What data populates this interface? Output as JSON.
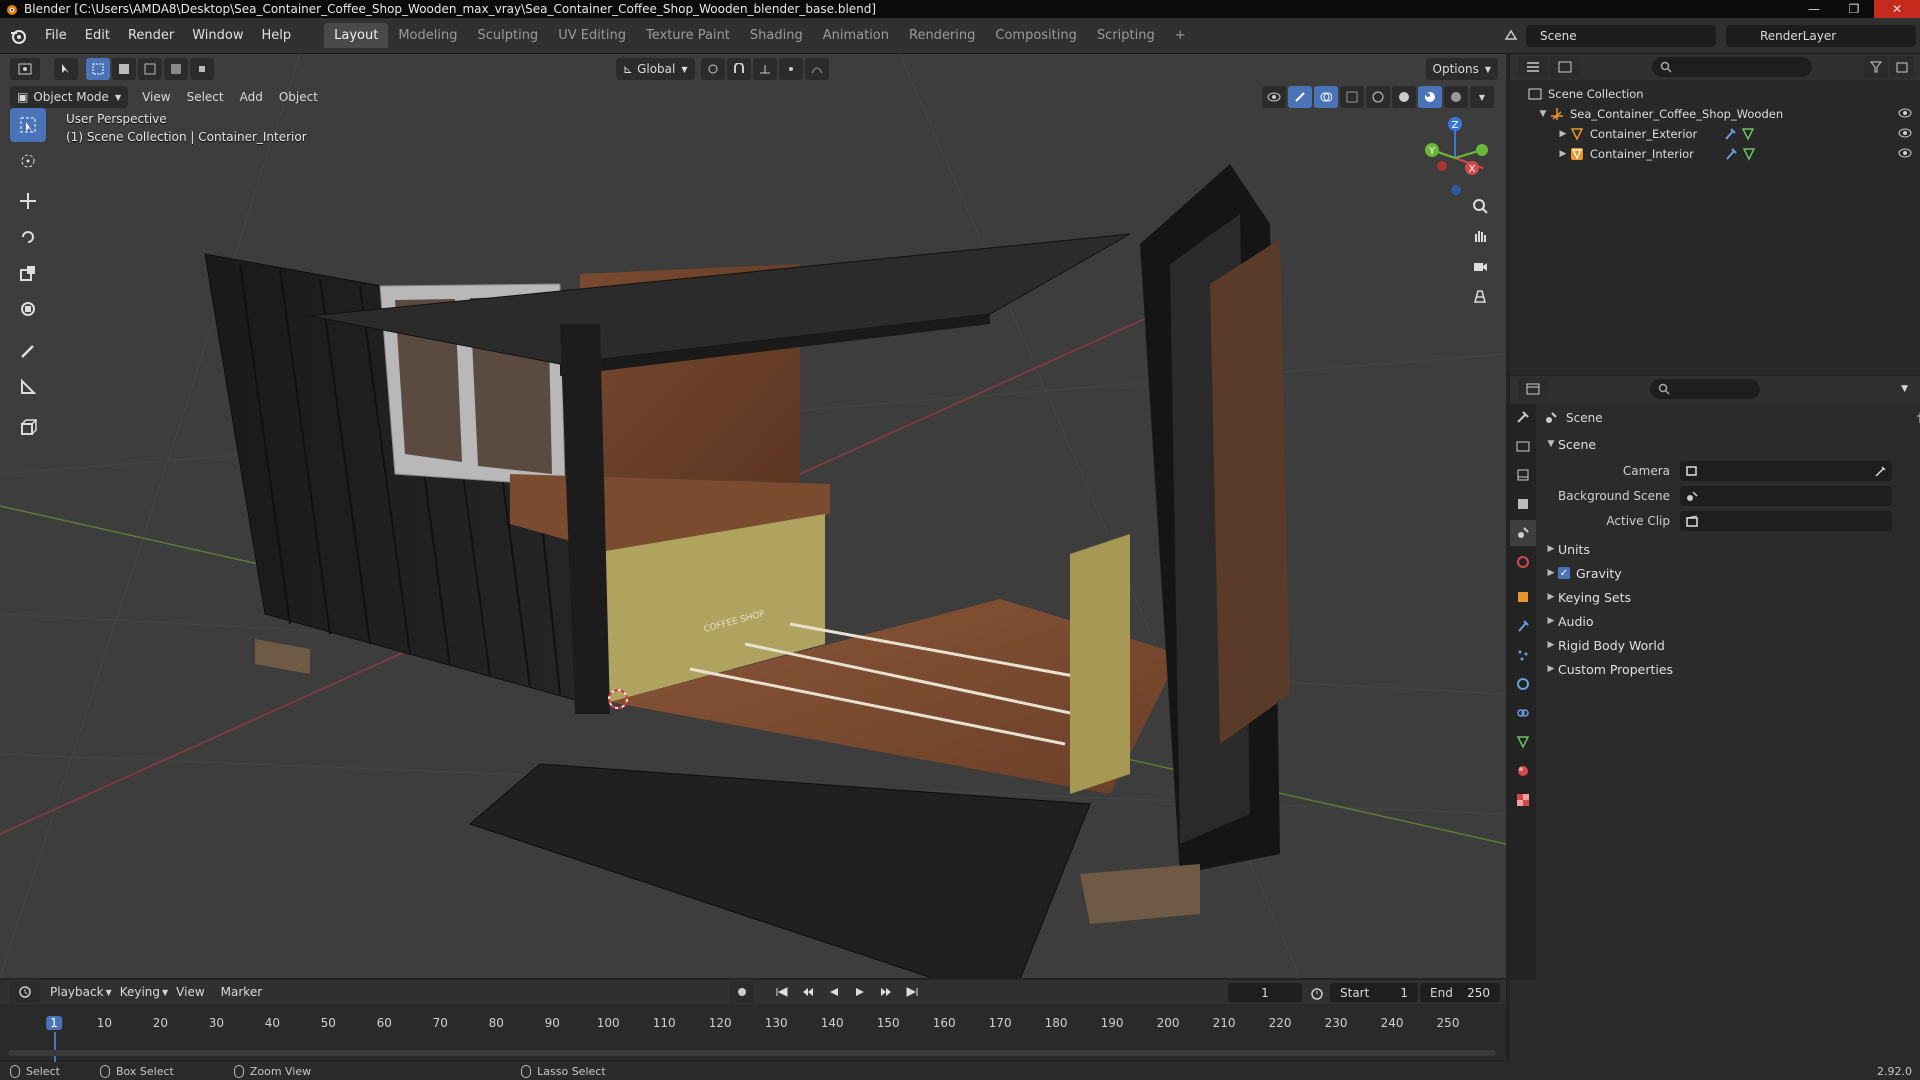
{
  "titlebar": {
    "title": "Blender [C:\\Users\\AMDA8\\Desktop\\Sea_Container_Coffee_Shop_Wooden_max_vray\\Sea_Container_Coffee_Shop_Wooden_blender_base.blend]",
    "min": "—",
    "max": "❐",
    "close": "✕"
  },
  "menu": [
    "File",
    "Edit",
    "Render",
    "Window",
    "Help"
  ],
  "workspaces": [
    "Layout",
    "Modeling",
    "Sculpting",
    "UV Editing",
    "Texture Paint",
    "Shading",
    "Animation",
    "Rendering",
    "Compositing",
    "Scripting"
  ],
  "workspace_add": "+",
  "scene_name": "Scene",
  "render_layer": "RenderLayer",
  "viewport": {
    "transform_orientation": "Global",
    "options_label": "Options",
    "mode": "Object Mode",
    "menus": [
      "View",
      "Select",
      "Add",
      "Object"
    ],
    "perspective": "User Perspective",
    "collection_info": "(1) Scene Collection | Container_Interior",
    "gizmo": {
      "x": "X",
      "y": "Y",
      "z": "Z"
    },
    "shop_sign": "COFFEE SHOP"
  },
  "outliner": {
    "root": "Scene Collection",
    "items": [
      {
        "name": "Sea_Container_Coffee_Shop_Wooden",
        "level": 1
      },
      {
        "name": "Container_Exterior",
        "level": 2
      },
      {
        "name": "Container_Interior",
        "level": 2
      }
    ]
  },
  "properties": {
    "header": "Scene",
    "panel_title": "Scene",
    "fields": [
      {
        "label": "Camera"
      },
      {
        "label": "Background Scene"
      },
      {
        "label": "Active Clip"
      }
    ],
    "panels": [
      "Units",
      "Gravity",
      "Keying Sets",
      "Audio",
      "Rigid Body World",
      "Custom Properties"
    ],
    "gravity_checked": true
  },
  "timeline": {
    "menus": [
      "Playback",
      "Keying",
      "View",
      "Marker"
    ],
    "current_frame": "1",
    "start_label": "Start",
    "start": "1",
    "end_label": "End",
    "end": "250",
    "ticks": [
      "1",
      "10",
      "20",
      "30",
      "40",
      "50",
      "60",
      "70",
      "80",
      "90",
      "100",
      "110",
      "120",
      "130",
      "140",
      "150",
      "160",
      "170",
      "180",
      "190",
      "200",
      "210",
      "220",
      "230",
      "240",
      "250"
    ]
  },
  "statusbar": {
    "select": "Select",
    "box_select": "Box Select",
    "zoom_view": "Zoom View",
    "lasso_select": "Lasso Select",
    "version": "2.92.0"
  }
}
